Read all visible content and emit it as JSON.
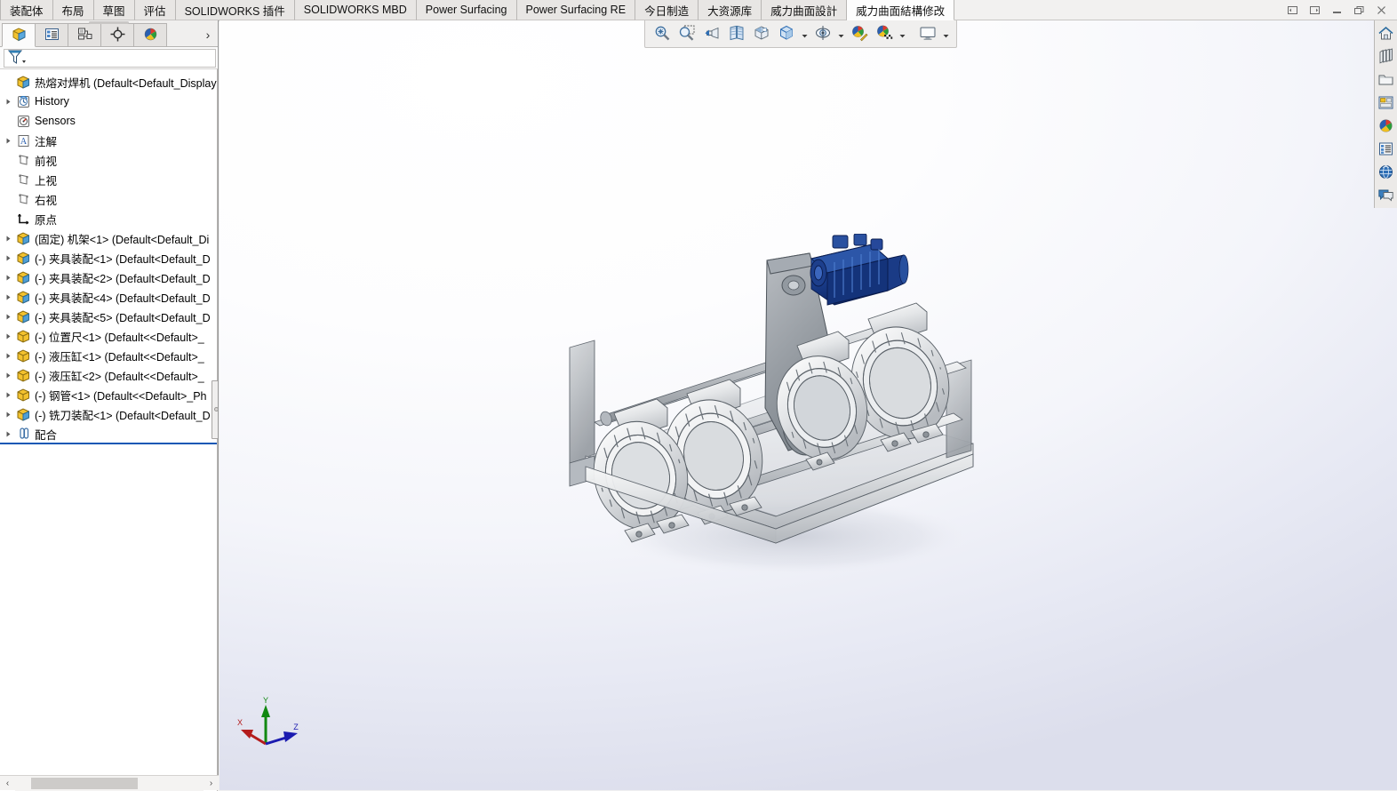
{
  "window": {
    "controls": [
      {
        "name": "restore-down-left-button",
        "glyph": "left-panel-icon"
      },
      {
        "name": "restore-down-right-button",
        "glyph": "right-panel-icon"
      },
      {
        "name": "minimize-button",
        "glyph": "minimize-icon"
      },
      {
        "name": "restore-button",
        "glyph": "restore-icon"
      },
      {
        "name": "close-button",
        "glyph": "close-icon"
      }
    ]
  },
  "ribbon": {
    "tabs": [
      {
        "label": "装配体",
        "active": false
      },
      {
        "label": "布局",
        "active": false
      },
      {
        "label": "草图",
        "active": false
      },
      {
        "label": "评估",
        "active": false
      },
      {
        "label": "SOLIDWORKS 插件",
        "active": false
      },
      {
        "label": "SOLIDWORKS MBD",
        "active": false
      },
      {
        "label": "Power Surfacing",
        "active": false
      },
      {
        "label": "Power Surfacing RE",
        "active": false
      },
      {
        "label": "今日制造",
        "active": false
      },
      {
        "label": "大资源库",
        "active": false
      },
      {
        "label": "威力曲面設計",
        "active": false
      },
      {
        "label": "威力曲面結構修改",
        "active": true
      }
    ]
  },
  "feature_manager": {
    "tabs": [
      {
        "name": "feature-tree-tab",
        "icon": "feature-tree-icon",
        "active": true
      },
      {
        "name": "property-manager-tab",
        "icon": "property-manager-icon",
        "active": false
      },
      {
        "name": "configuration-manager-tab",
        "icon": "configuration-manager-icon",
        "active": false
      },
      {
        "name": "dimxpert-manager-tab",
        "icon": "dimxpert-icon",
        "active": false
      },
      {
        "name": "display-manager-tab",
        "icon": "display-manager-icon",
        "active": false
      }
    ],
    "overflow_label": "›",
    "filter": {
      "icon": "filter-funnel-icon",
      "value": "",
      "placeholder": ""
    },
    "tree": [
      {
        "label": "热熔对焊机  (Default<Default_Display St",
        "icon": "assembly-icon",
        "twisty": false,
        "level": 0
      },
      {
        "label": "History",
        "icon": "history-icon",
        "twisty": true,
        "level": 1
      },
      {
        "label": "Sensors",
        "icon": "sensors-icon",
        "twisty": false,
        "level": 1
      },
      {
        "label": "注解",
        "icon": "annotations-icon",
        "twisty": true,
        "level": 1
      },
      {
        "label": "前视",
        "icon": "plane-icon",
        "twisty": false,
        "level": 1
      },
      {
        "label": "上视",
        "icon": "plane-icon",
        "twisty": false,
        "level": 1
      },
      {
        "label": "右视",
        "icon": "plane-icon",
        "twisty": false,
        "level": 1
      },
      {
        "label": "原点",
        "icon": "origin-icon",
        "twisty": false,
        "level": 1
      },
      {
        "label": "(固定) 机架<1>  (Default<Default_Di",
        "icon": "part-icon",
        "twisty": true,
        "level": 1
      },
      {
        "label": "(-) 夹具装配<1>  (Default<Default_D",
        "icon": "part-icon",
        "twisty": true,
        "level": 1
      },
      {
        "label": "(-) 夹具装配<2>  (Default<Default_D",
        "icon": "part-icon",
        "twisty": true,
        "level": 1
      },
      {
        "label": "(-) 夹具装配<4>  (Default<Default_D",
        "icon": "part-icon",
        "twisty": true,
        "level": 1
      },
      {
        "label": "(-) 夹具装配<5>  (Default<Default_D",
        "icon": "part-icon",
        "twisty": true,
        "level": 1
      },
      {
        "label": "(-) 位置尺<1>  (Default<<Default>_",
        "icon": "subpart-icon",
        "twisty": true,
        "level": 1
      },
      {
        "label": "(-) 液压缸<1>  (Default<<Default>_",
        "icon": "subpart-icon",
        "twisty": true,
        "level": 1
      },
      {
        "label": "(-) 液压缸<2>  (Default<<Default>_",
        "icon": "subpart-icon",
        "twisty": true,
        "level": 1
      },
      {
        "label": "(-) 钢管<1>  (Default<<Default>_Ph",
        "icon": "subpart-icon",
        "twisty": true,
        "level": 1
      },
      {
        "label": "(-) 铣刀装配<1>  (Default<Default_D",
        "icon": "part-icon",
        "twisty": true,
        "level": 1
      },
      {
        "label": "配合",
        "icon": "mates-icon",
        "twisty": true,
        "level": 1
      }
    ],
    "scrollbar": {
      "left_arrow": "‹",
      "right_arrow": "›"
    }
  },
  "view_toolbar": {
    "buttons": [
      {
        "name": "zoom-to-fit-button",
        "icon": "zoom-to-fit-icon",
        "caret": false
      },
      {
        "name": "zoom-to-area-button",
        "icon": "zoom-to-area-icon",
        "caret": false
      },
      {
        "name": "previous-view-button",
        "icon": "previous-view-icon",
        "caret": false
      },
      {
        "name": "section-view-button",
        "icon": "section-view-icon",
        "caret": false
      },
      {
        "name": "view-orientation-button",
        "icon": "view-orientation-icon",
        "caret": false
      },
      {
        "name": "display-style-button",
        "icon": "display-style-icon",
        "caret": true
      },
      {
        "name": "hide-show-items-button",
        "icon": "hide-show-icon",
        "caret": true
      },
      {
        "name": "edit-appearance-button",
        "icon": "edit-appearance-icon",
        "caret": false
      },
      {
        "name": "apply-scene-button",
        "icon": "apply-scene-icon",
        "caret": true
      },
      {
        "name": "view-settings-button",
        "icon": "view-settings-icon",
        "caret": true
      }
    ]
  },
  "task_pane": {
    "buttons": [
      {
        "name": "solidworks-resources-button",
        "icon": "home-icon"
      },
      {
        "name": "design-library-button",
        "icon": "design-library-icon"
      },
      {
        "name": "file-explorer-button",
        "icon": "folder-icon"
      },
      {
        "name": "view-palette-button",
        "icon": "view-palette-icon"
      },
      {
        "name": "appearances-scenes-button",
        "icon": "appearances-icon"
      },
      {
        "name": "custom-properties-button",
        "icon": "custom-properties-icon"
      },
      {
        "name": "3d-content-central-button",
        "icon": "globe-icon"
      },
      {
        "name": "technical-alerts-button",
        "icon": "comments-icon"
      }
    ]
  },
  "viewport": {
    "triad": {
      "x_label": "X",
      "y_label": "Y",
      "z_label": "Z",
      "x_color": "#b41c1c",
      "y_color": "#118811",
      "z_color": "#1b1bb0"
    },
    "model_name": "热熔对焊机",
    "background_top": "#ffffff",
    "background_bottom": "#dcdeec",
    "highlight_color": "#1358b5"
  }
}
